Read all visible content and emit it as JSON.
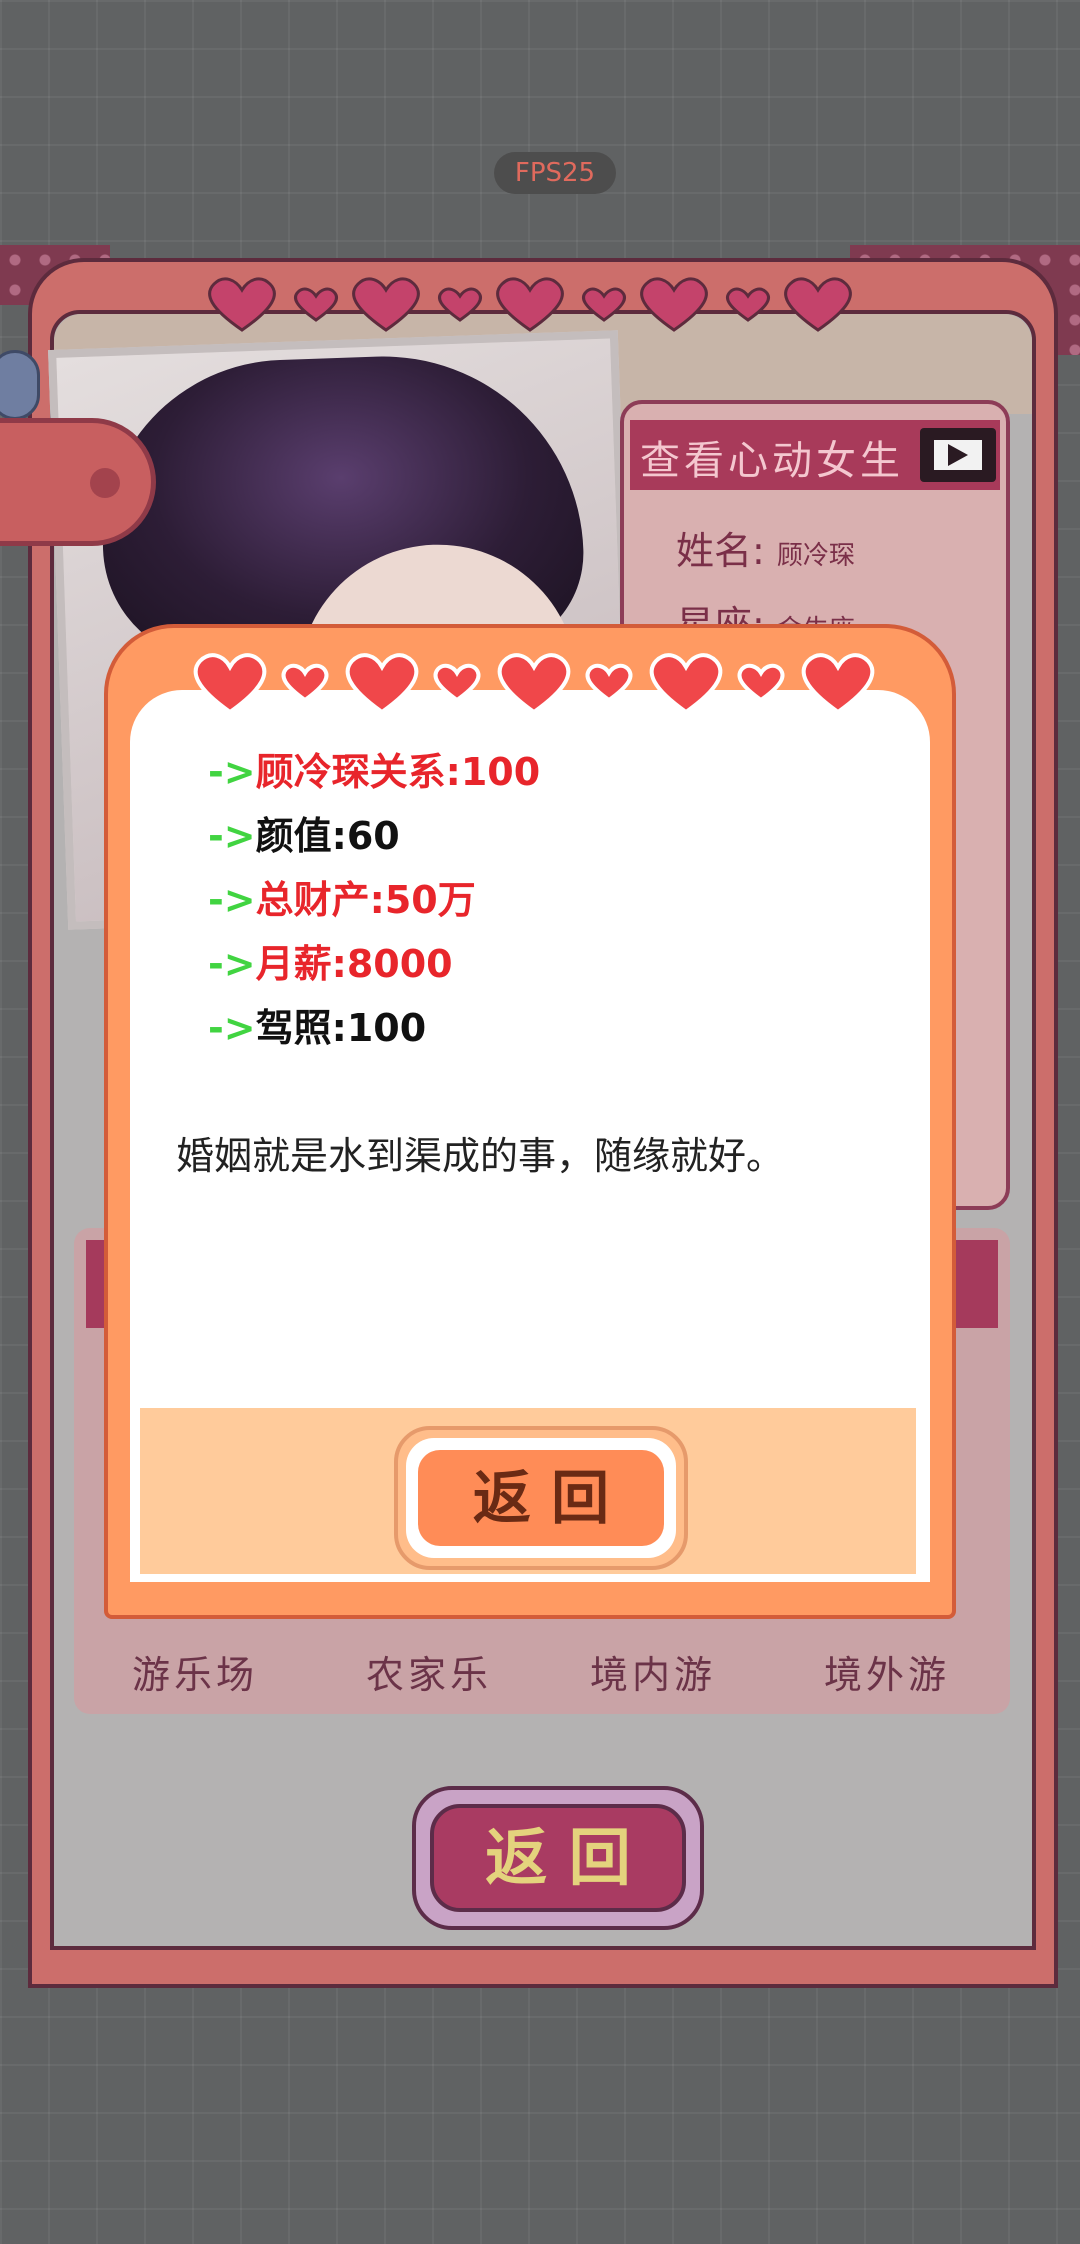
{
  "hud": {
    "fps": "FPS25"
  },
  "profile": {
    "header_title": "查看心动女生",
    "name_label": "姓名:",
    "name_value": "顾冷琛",
    "sign_label": "星座:",
    "sign_value": "金牛座"
  },
  "destinations": [
    "游乐场",
    "农家乐",
    "境内游",
    "境外游"
  ],
  "bottom_button": "返 回",
  "modal": {
    "stats": [
      {
        "arrow": "->",
        "label": "顾冷琛关系:100",
        "color": "#e8252b"
      },
      {
        "arrow": "->",
        "label": "颜值:60",
        "color": "#111111"
      },
      {
        "arrow": "->",
        "label": "总财产:50万",
        "color": "#e8252b"
      },
      {
        "arrow": "->",
        "label": "月薪:8000",
        "color": "#e8252b"
      },
      {
        "arrow": "->",
        "label": "驾照:100",
        "color": "#111111"
      }
    ],
    "description": "婚姻就是水到渠成的事，随缘就好。",
    "return_button": "返 回"
  },
  "colors": {
    "heart": "#f0474a",
    "modal_orange": "#ff9a62",
    "card_pink": "#cc6e6b"
  }
}
